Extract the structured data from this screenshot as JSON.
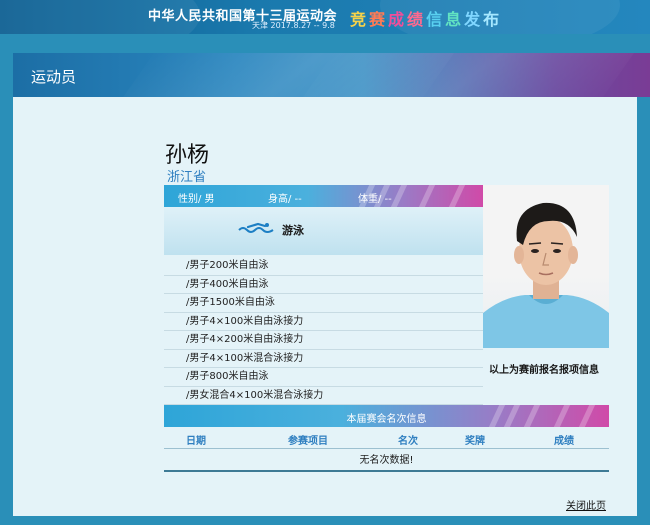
{
  "banner": {
    "title": "中华人民共和国第十三届运动会",
    "subtitle": "天津 2017.8.27 -- 9.8",
    "release": [
      "竞",
      "赛",
      "成",
      "绩",
      "信",
      "息",
      "发",
      "布"
    ]
  },
  "section": {
    "title": "运动员"
  },
  "athlete": {
    "name": "孙杨",
    "region": "浙江省",
    "gender": "性别/ 男",
    "height": "身高/ --",
    "weight": "体重/ --",
    "sport": "游泳",
    "sport_icon": "swimming-icon",
    "events": [
      "/男子200米自由泳",
      "/男子400米自由泳",
      "/男子1500米自由泳",
      "/男子4×100米自由泳接力",
      "/男子4×200米自由泳接力",
      "/男子4×100米混合泳接力",
      "/男子800米自由泳",
      "/男女混合4×100米混合泳接力"
    ],
    "photo_caption": "以上为赛前报名报项信息"
  },
  "rankings": {
    "title": "本届赛会名次信息",
    "columns": [
      "日期",
      "参赛项目",
      "名次",
      "奖牌",
      "成绩"
    ],
    "empty_text": "无名次数据!"
  },
  "footer": {
    "close_label": "关闭此页"
  },
  "colors": {
    "accent_blue": "#2ea5d8",
    "accent_magenta": "#d04aa8",
    "link_blue": "#2f7fc0",
    "panel_bg": "#e4f3f8"
  }
}
